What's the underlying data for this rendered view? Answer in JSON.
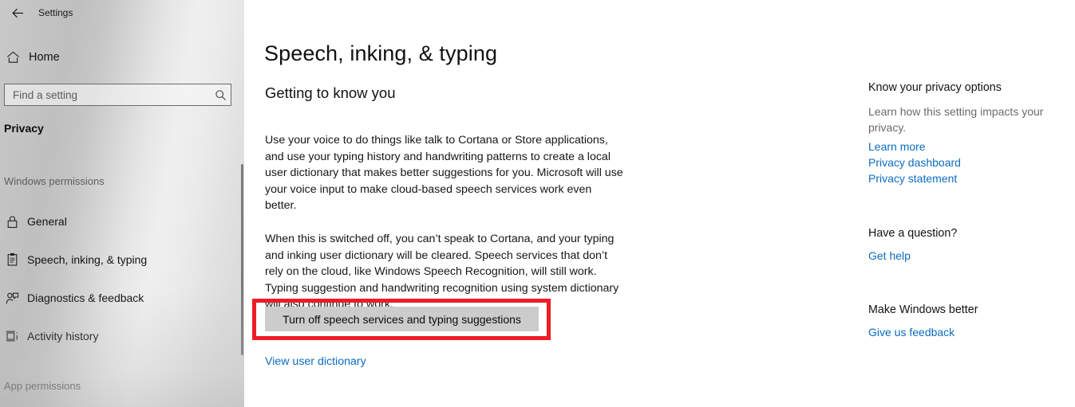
{
  "window": {
    "app_title": "Settings",
    "back_icon": "back-arrow-icon",
    "controls": {
      "minimize": "minimize-icon",
      "restore": "restore-icon",
      "close": "close-icon"
    }
  },
  "sidebar": {
    "home": {
      "label": "Home",
      "icon": "home-icon"
    },
    "search": {
      "value": "",
      "placeholder": "Find a setting",
      "icon": "search-icon"
    },
    "category": "Privacy",
    "groups": [
      {
        "label": "Windows permissions",
        "items": [
          {
            "label": "General",
            "icon": "lock-icon"
          },
          {
            "label": "Speech, inking, & typing",
            "icon": "clipboard-icon"
          },
          {
            "label": "Diagnostics & feedback",
            "icon": "person-feedback-icon"
          },
          {
            "label": "Activity history",
            "icon": "timeline-icon"
          }
        ]
      },
      {
        "label": "App permissions",
        "items": []
      }
    ]
  },
  "main": {
    "page_title": "Speech, inking, & typing",
    "section_title": "Getting to know you",
    "paragraph_1": "Use your voice to do things like talk to Cortana or Store applications, and use your typing history and handwriting patterns to create a local user dictionary that makes better suggestions for you. Microsoft will use your voice input to make cloud-based speech services work even better.",
    "paragraph_2": "When this is switched off, you can’t speak to Cortana, and your typing and inking user dictionary will be cleared. Speech services that don’t rely on the cloud, like Windows Speech Recognition, will still work. Typing suggestion and handwriting recognition using system dictionary will also continue to work.",
    "toggle_button": "Turn off speech services and typing suggestions",
    "dictionary_link": "View user dictionary",
    "highlight_color": "#ee1c25"
  },
  "right_rail": {
    "privacy": {
      "heading": "Know your privacy options",
      "description": "Learn how this setting impacts your privacy.",
      "links": [
        "Learn more",
        "Privacy dashboard",
        "Privacy statement"
      ]
    },
    "question": {
      "heading": "Have a question?",
      "links": [
        "Get help"
      ]
    },
    "better": {
      "heading": "Make Windows better",
      "links": [
        "Give us feedback"
      ]
    },
    "link_color": "#0b6cc1"
  }
}
